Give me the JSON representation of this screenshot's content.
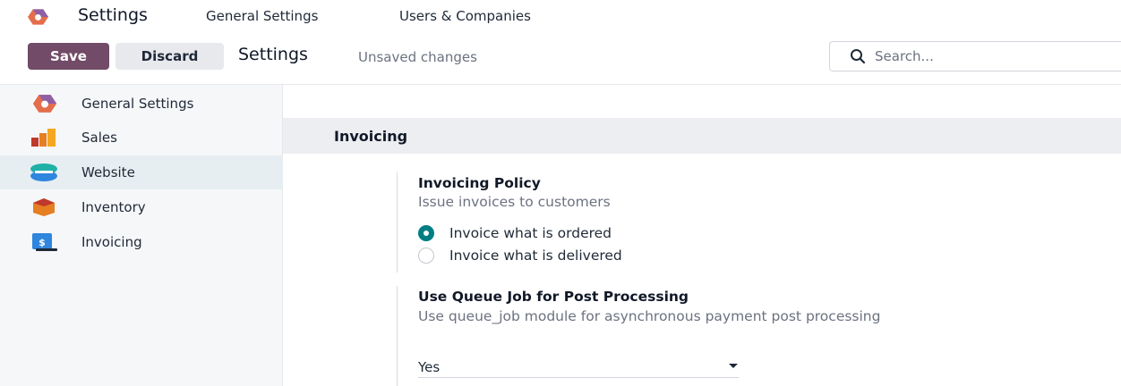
{
  "topnav": {
    "app_title": "Settings",
    "menu": [
      "General Settings",
      "Users & Companies"
    ]
  },
  "control_panel": {
    "save_label": "Save",
    "discard_label": "Discard",
    "breadcrumb": "Settings",
    "status": "Unsaved changes",
    "search_placeholder": "Search..."
  },
  "sidebar": {
    "items": [
      {
        "label": "General Settings",
        "icon": "odoo-logo-icon"
      },
      {
        "label": "Sales",
        "icon": "sales-app-icon"
      },
      {
        "label": "Website",
        "icon": "website-app-icon",
        "active": true
      },
      {
        "label": "Inventory",
        "icon": "inventory-app-icon"
      },
      {
        "label": "Invoicing",
        "icon": "invoicing-app-icon"
      }
    ]
  },
  "main": {
    "section_title": "Invoicing",
    "settings": [
      {
        "title": "Invoicing Policy",
        "description": "Issue invoices to customers",
        "options": [
          {
            "label": "Invoice what is ordered",
            "checked": true
          },
          {
            "label": "Invoice what is delivered",
            "checked": false
          }
        ]
      },
      {
        "title": "Use Queue Job for Post Processing",
        "description": "Use queue_job module for asynchronous payment post processing",
        "selected_value": "Yes"
      }
    ]
  },
  "colors": {
    "primary": "#714B67",
    "radio_checked": "#017e84",
    "sidebar_active": "#e6eef2",
    "section_band": "#eceef1"
  }
}
